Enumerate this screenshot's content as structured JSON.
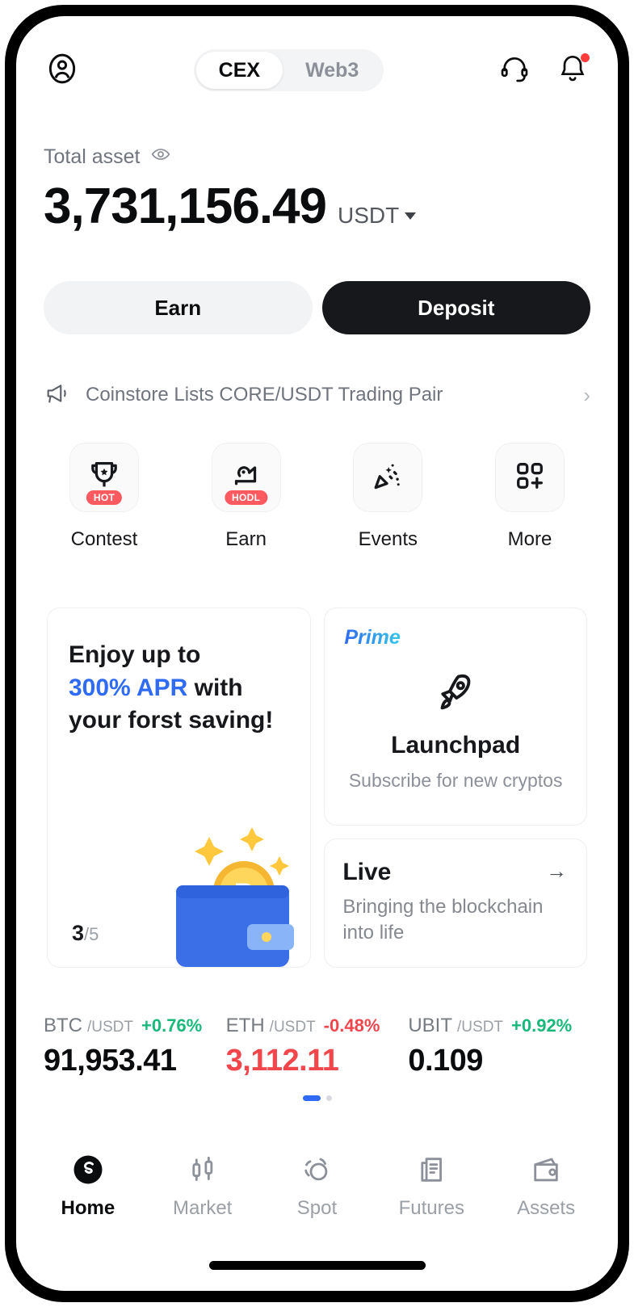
{
  "header": {
    "profile_icon": "user-circle-icon",
    "tabs": [
      {
        "label": "CEX",
        "active": true
      },
      {
        "label": "Web3",
        "active": false
      }
    ],
    "support_icon": "headset-icon",
    "notification_icon": "bell-icon",
    "notification_badge": true
  },
  "balance": {
    "label": "Total asset",
    "eye_icon": "eye-icon",
    "amount": "3,731,156.49",
    "currency": "USDT",
    "currency_caret": "chevron-down-icon"
  },
  "actions": {
    "earn_label": "Earn",
    "deposit_label": "Deposit"
  },
  "announcement": {
    "icon": "megaphone-icon",
    "text": "Coinstore Lists CORE/USDT Trading Pair",
    "chevron": "chevron-right-icon"
  },
  "quick_actions": [
    {
      "label": "Contest",
      "icon": "trophy-icon",
      "badge": "HOT"
    },
    {
      "label": "Earn",
      "icon": "piggy-hand-icon",
      "badge": "HODL"
    },
    {
      "label": "Events",
      "icon": "confetti-icon",
      "badge": ""
    },
    {
      "label": "More",
      "icon": "grid-plus-icon",
      "badge": ""
    }
  ],
  "promo_card": {
    "line1": "Enjoy up to",
    "highlight": "300% APR",
    "line2_tail": " with",
    "line3": "your forst saving!",
    "counter_current": "3",
    "counter_total": "/5",
    "art": "wallet-bitcoin-illustration"
  },
  "launchpad_card": {
    "tag": "Prime",
    "icon": "rocket-icon",
    "title": "Launchpad",
    "subtitle": "Subscribe for new cryptos"
  },
  "live_card": {
    "title": "Live",
    "arrow_icon": "arrow-right-icon",
    "subtitle": "Bringing the blockchain into life"
  },
  "tickers": [
    {
      "base": "BTC",
      "quote": "/USDT",
      "change": "+0.76%",
      "direction": "up",
      "price": "91,953.41",
      "price_direction": "neutral"
    },
    {
      "base": "ETH",
      "quote": "/USDT",
      "change": "-0.48%",
      "direction": "down",
      "price": "3,112.11",
      "price_direction": "down"
    },
    {
      "base": "UBIT",
      "quote": "/USDT",
      "change": "+0.92%",
      "direction": "up",
      "price": "0.109",
      "price_direction": "neutral"
    }
  ],
  "carousel_dots": {
    "count": 2,
    "active_index": 0
  },
  "bottom_nav": [
    {
      "label": "Home",
      "icon": "coinstore-logo-icon",
      "active": true
    },
    {
      "label": "Market",
      "icon": "candlestick-icon",
      "active": false
    },
    {
      "label": "Spot",
      "icon": "swap-circles-icon",
      "active": false
    },
    {
      "label": "Futures",
      "icon": "document-chart-icon",
      "active": false
    },
    {
      "label": "Assets",
      "icon": "wallet-icon",
      "active": false
    }
  ],
  "colors": {
    "accent_blue": "#2f6bf5",
    "up_green": "#19b97b",
    "down_red": "#f0464c",
    "badge_red": "#ff5a5f",
    "dark": "#17181b"
  }
}
